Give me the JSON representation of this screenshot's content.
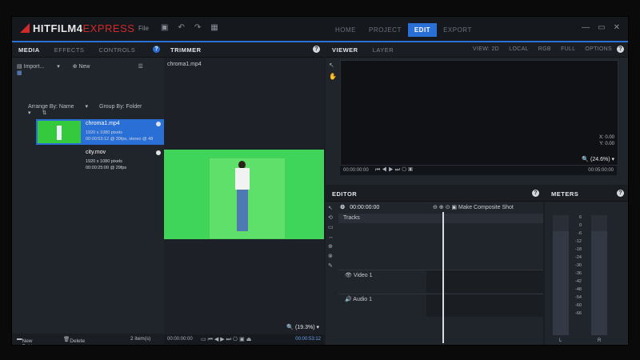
{
  "app": {
    "brand_main": "HITFILM4",
    "brand_accent": "EXPRESS",
    "file_menu": "File"
  },
  "modes": [
    "HOME",
    "PROJECT",
    "EDIT",
    "EXPORT"
  ],
  "media_panel": {
    "tabs": [
      "MEDIA",
      "EFFECTS",
      "CONTROLS"
    ],
    "import_label": "Import...",
    "new_label": "New",
    "arrange_label": "Arrange By: Name",
    "group_label": "Group By: Folder",
    "items": [
      {
        "name": "chroma1.mp4",
        "res": "1920 x 1080 pixels",
        "info": "00:00:53:12 @ 30fps, stereo @ 48"
      },
      {
        "name": "city.mov",
        "res": "1920 x 1080 pixels",
        "info": "00:00:25:00 @ 29fps"
      }
    ],
    "new_folder": "New Folder",
    "delete": "Delete",
    "count": "2 item(s)"
  },
  "trimmer": {
    "tab": "TRIMMER",
    "file": "chroma1.mp4",
    "zoom": "(19.3%)",
    "timecode_start": "00:00:00:00",
    "timecode_end": "00:00:53:12"
  },
  "viewer": {
    "tabs": [
      "VIEWER",
      "LAYER"
    ],
    "options": [
      "VIEW: 2D",
      "LOCAL",
      "RGB",
      "FULL",
      "OPTIONS"
    ],
    "x_label": "X:",
    "x_value": "0.00",
    "y_label": "Y:",
    "y_value": "0.00",
    "zoom": "(24.6%)",
    "timecode_start": "00:00:00:00",
    "timecode_end": "00:05:00:00"
  },
  "editor": {
    "tab": "EDITOR",
    "timecode": "00:00:00:00",
    "make_composite": "Make Composite Shot",
    "tracks_label": "Tracks",
    "video_track": "Video 1",
    "audio_track": "Audio 1"
  },
  "meters": {
    "tab": "METERS",
    "scale": [
      "6",
      "0",
      "-6",
      "-12",
      "-18",
      "-24",
      "-30",
      "-36",
      "-42",
      "-48",
      "-54",
      "-60",
      "-66"
    ],
    "left": "L",
    "right": "R"
  }
}
